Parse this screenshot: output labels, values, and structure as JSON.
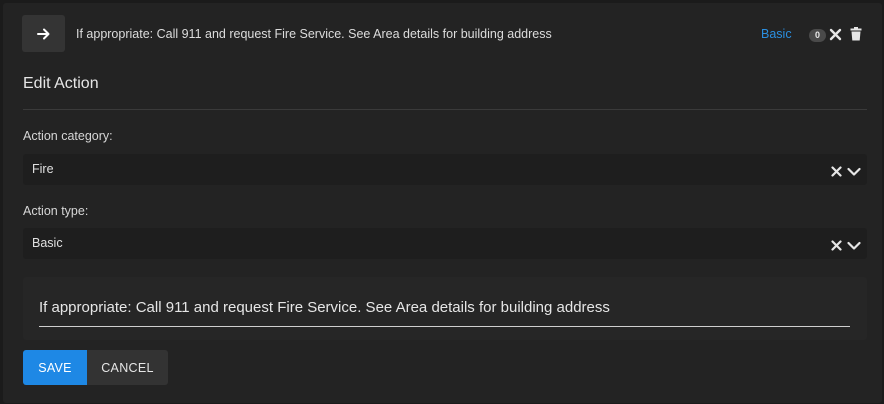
{
  "header": {
    "arrow_icon": "arrow-right-icon",
    "text": "If appropriate: Call 911 and request Fire Service. See Area details for building address",
    "type_link": "Basic",
    "count": "0",
    "close_icon": "close-icon",
    "delete_icon": "trash-icon"
  },
  "editor": {
    "title": "Edit Action",
    "category": {
      "label": "Action category:",
      "value": "Fire"
    },
    "type": {
      "label": "Action type:",
      "value": "Basic"
    },
    "description_value": "If appropriate: Call 911 and request Fire Service. See Area details for building address",
    "save_label": "SAVE",
    "cancel_label": "CANCEL"
  },
  "colors": {
    "accent": "#1e88e5",
    "link": "#2b8fe0",
    "background": "#1b1b1b",
    "panel": "#232323"
  }
}
